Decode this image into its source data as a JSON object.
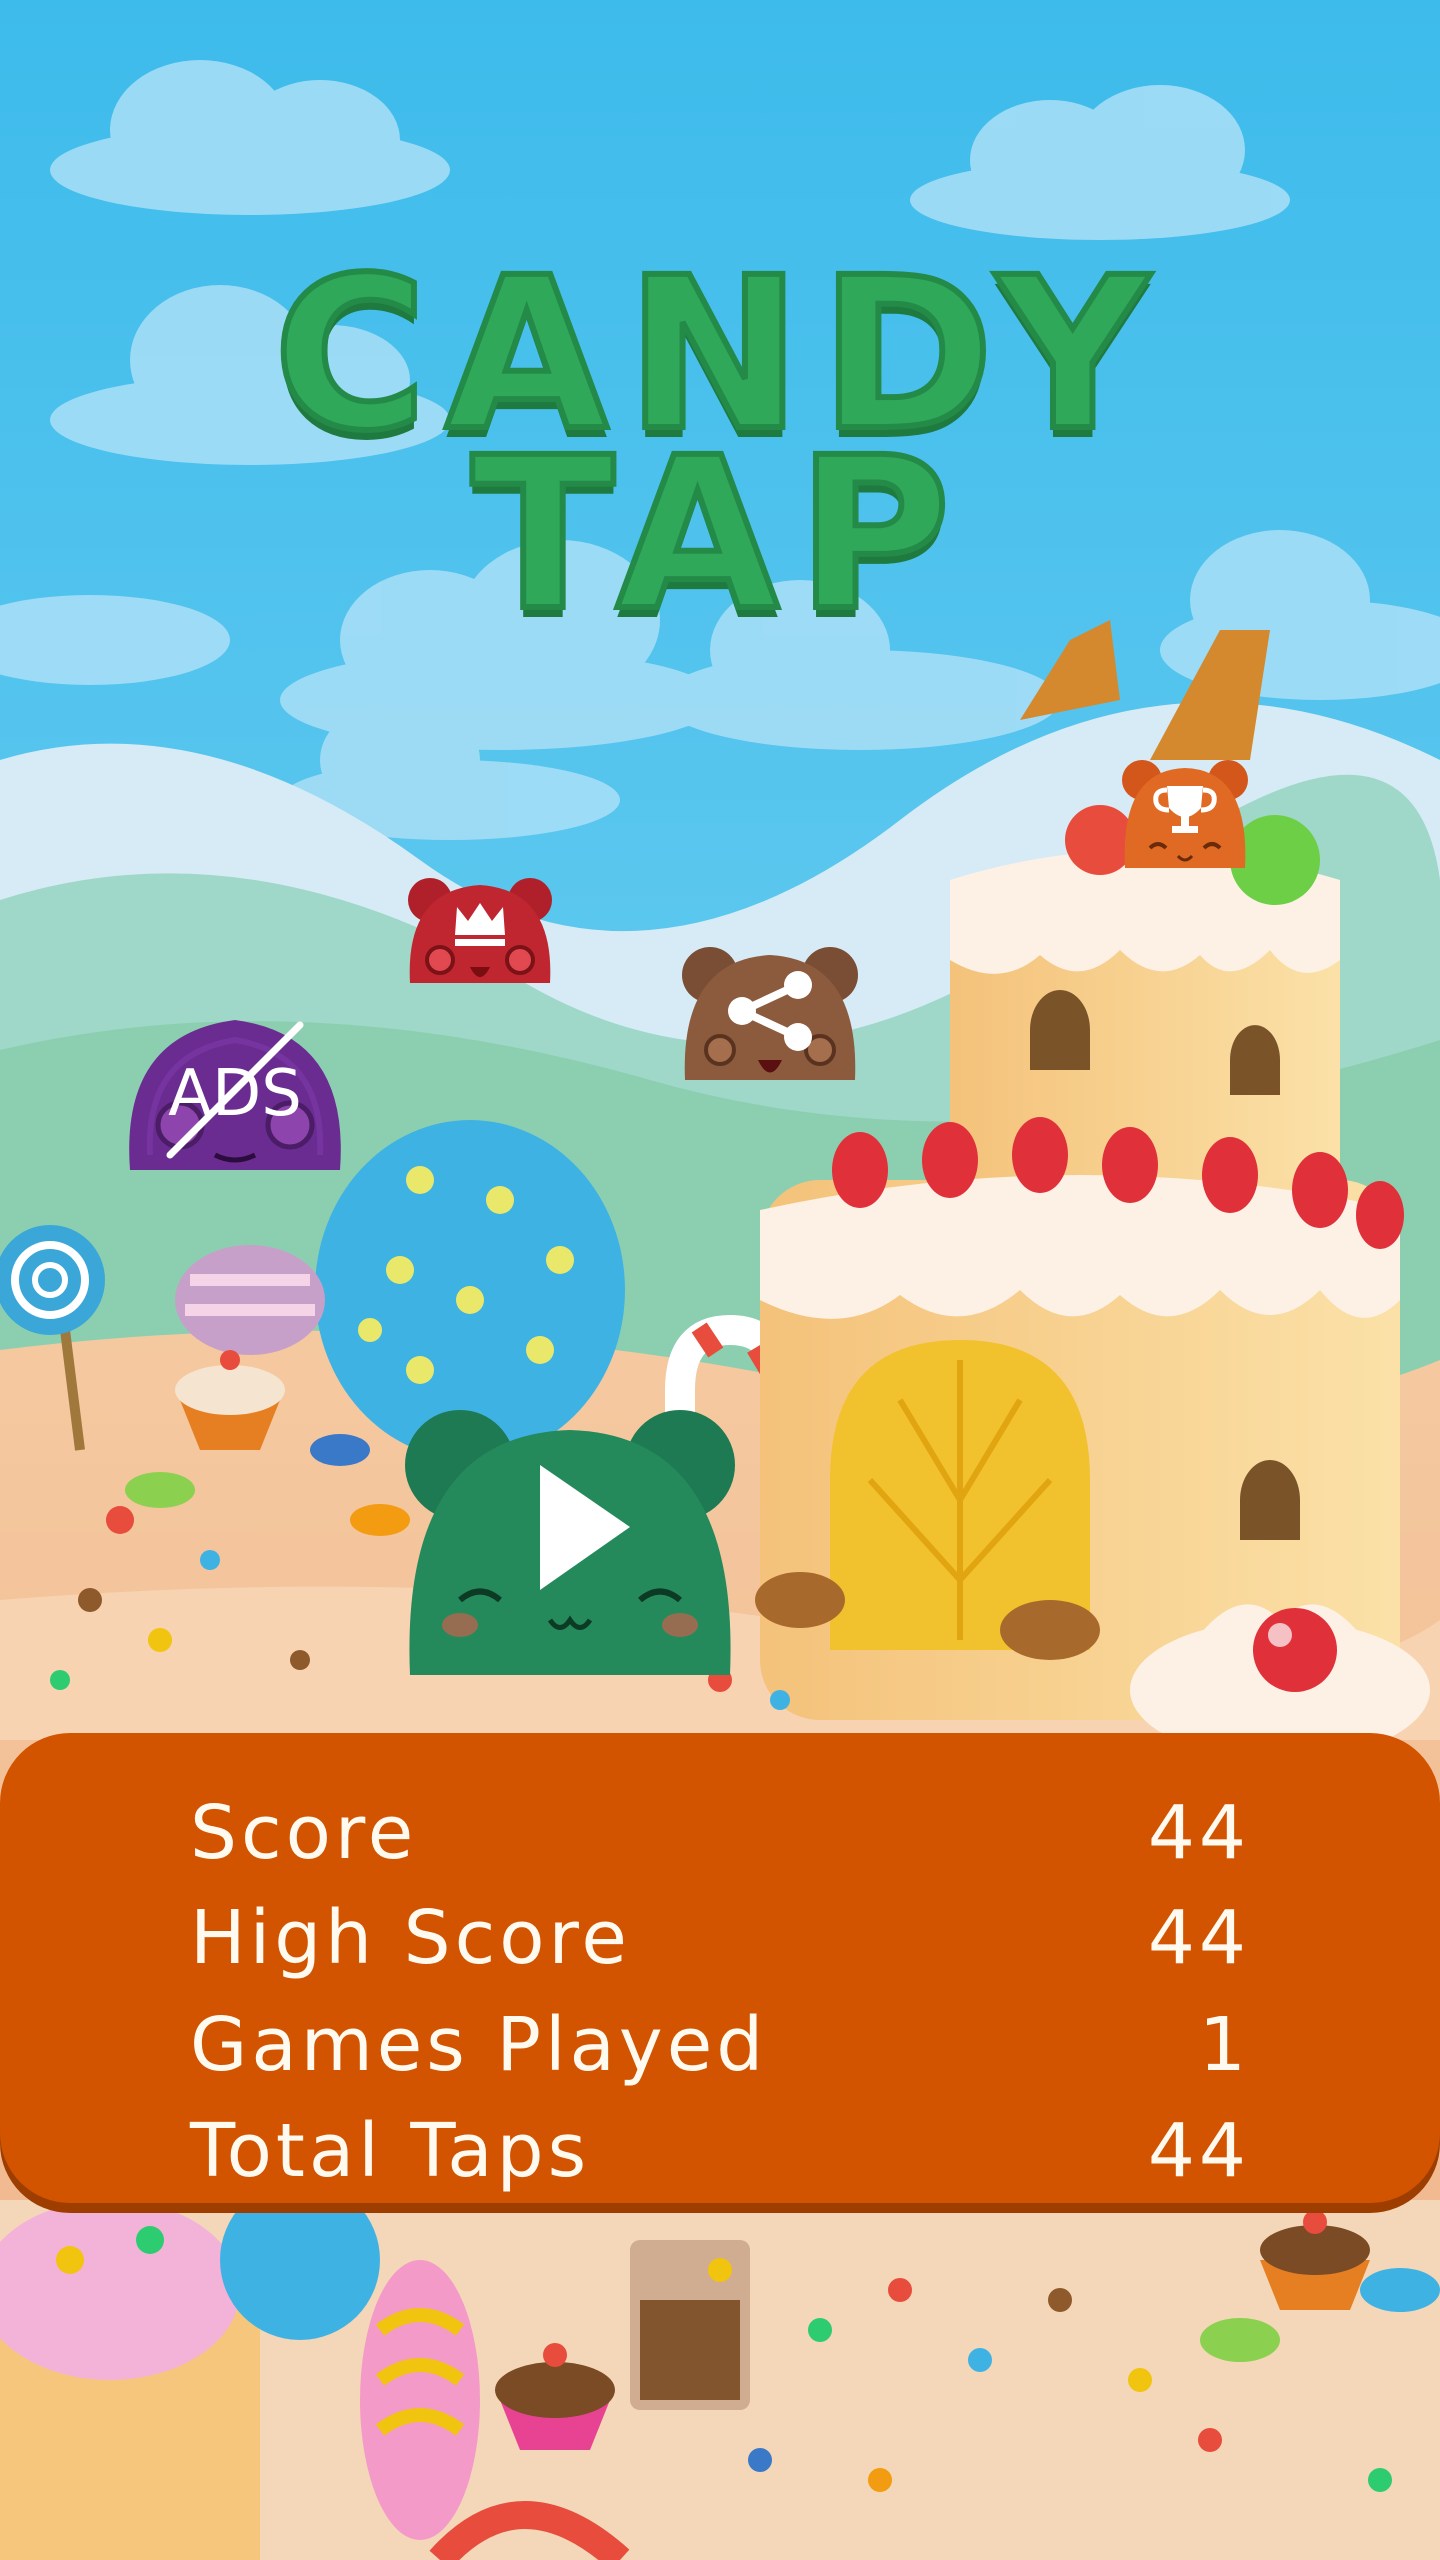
{
  "title": {
    "line1": "CANDY",
    "line2": "TAP"
  },
  "buttons": {
    "remove_ads_label": "ADS",
    "leaderboard": "crown-icon",
    "share": "share-icon",
    "achievements": "trophy-icon",
    "play": "play-icon"
  },
  "stats": [
    {
      "label": "Score",
      "value": "44"
    },
    {
      "label": "High Score",
      "value": "44"
    },
    {
      "label": "Games Played",
      "value": "1"
    },
    {
      "label": "Total Taps",
      "value": "44"
    }
  ],
  "colors": {
    "sky": "#3fb9ea",
    "title_green": "#2fa85a",
    "panel": "#d35400",
    "panel_text": "#fffaf0"
  }
}
